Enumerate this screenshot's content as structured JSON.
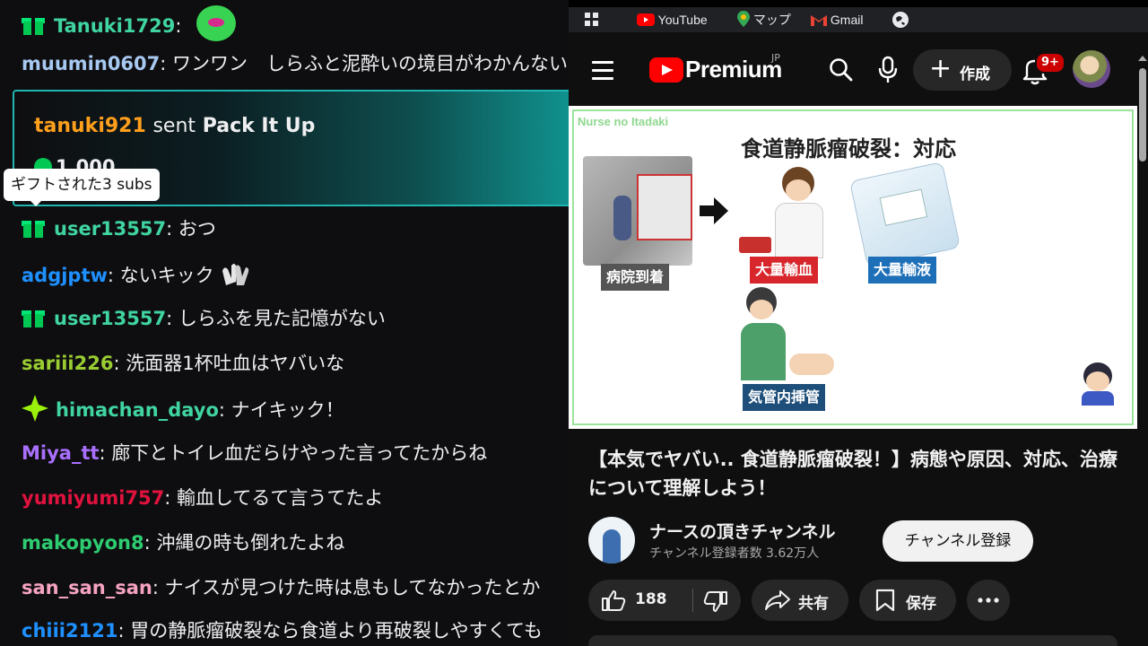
{
  "chat": {
    "messages": [
      {
        "user": "Tanuki1729",
        "text": "",
        "color": "#3fd4a0",
        "badge": "gift",
        "emote": "green-blob-emote"
      },
      {
        "user": "muumin0607",
        "text": "ワンワン　しらふと泥酔いの境目がわかんない",
        "color": "#a7c8f0",
        "badge": ""
      },
      {
        "user": "user13557",
        "text": "おつ",
        "color": "#3fd4a0",
        "badge": "gift"
      },
      {
        "user": "adgjptw",
        "text": "ないキック",
        "color": "#1e90ff",
        "badge": "",
        "emote": "hands-emote"
      },
      {
        "user": "user13557",
        "text": "しらふを見た記憶がない",
        "color": "#3fd4a0",
        "badge": "gift"
      },
      {
        "user": "sariii226",
        "text": "洗面器1杯吐血はヤバいな",
        "color": "#9acd32",
        "badge": ""
      },
      {
        "user": "himachan_dayo",
        "text": "ナイキック！",
        "color": "#3fd4a0",
        "badge": "sparkle"
      },
      {
        "user": "Miya_tt",
        "text": "廊下とトイレ血だらけやった言ってたからね",
        "color": "#a970ff",
        "badge": ""
      },
      {
        "user": "yumiyumi757",
        "text": "輸血してるて言うてたよ",
        "color": "#e0123e",
        "badge": ""
      },
      {
        "user": "makopyon8",
        "text": "沖縄の時も倒れたよね",
        "color": "#2ecc71",
        "badge": ""
      },
      {
        "user": "san_san_san",
        "text": "ナイスが見つけた時は息もしてなかったとか",
        "color": "#f5a3c0",
        "badge": ""
      },
      {
        "user": "chiii2121",
        "text": "胃の静脈瘤破裂なら食道より再破裂しやすくても",
        "color": "#1e90ff",
        "badge": ""
      }
    ],
    "gift_card": {
      "sender": "tanuki921",
      "sent_word": "sent",
      "item": "Pack It Up",
      "amount": "1,000",
      "sender_color": "#ff9f1c"
    },
    "tooltip": "ギフトされた3 subs"
  },
  "browser": {
    "bookmarks": [
      {
        "label": "",
        "icon": "apps-grid-icon"
      },
      {
        "label": "YouTube",
        "icon": "youtube-icon"
      },
      {
        "label": "マップ",
        "icon": "maps-pin-icon"
      },
      {
        "label": "Gmail",
        "icon": "gmail-icon"
      },
      {
        "label": "",
        "icon": "globe-icon"
      }
    ]
  },
  "youtube": {
    "logo_text": "Premium",
    "region": "JP",
    "create_label": "作成",
    "notification_count": "9+",
    "thumbnail": {
      "brand": "Nurse no Itadaki",
      "heading": "食道静脈瘤破裂：対応",
      "labels": {
        "arrival": "病院到着",
        "transfusion": "大量輸血",
        "infusion": "大量輸液",
        "intubation": "気管内挿管"
      }
    },
    "video_title": "【本気でヤバい.. 食道静脈瘤破裂！】病態や原因、対応、治療について理解しよう！",
    "channel_name": "ナースの頂きチャンネル",
    "channel_subs": "チャンネル登録者数 3.62万人",
    "subscribe_label": "チャンネル登録",
    "like_count": "188",
    "share_label": "共有",
    "save_label": "保存",
    "colors": {
      "accent_red": "#ff0000",
      "label_red": "#d7262c",
      "label_blue": "#1d6fb8",
      "label_navy": "#1e4f7a",
      "label_gray": "#555555"
    }
  }
}
